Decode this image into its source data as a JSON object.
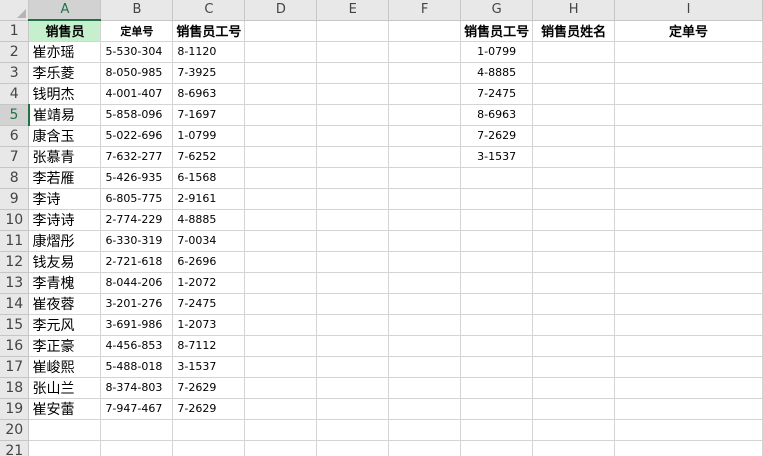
{
  "columns": [
    "A",
    "B",
    "C",
    "D",
    "E",
    "F",
    "G",
    "H",
    "I"
  ],
  "selected_column": "A",
  "selected_row": 5,
  "row_numbers": [
    "1",
    "2",
    "3",
    "4",
    "5",
    "6",
    "7",
    "8",
    "9",
    "10",
    "11",
    "12",
    "13",
    "14",
    "15",
    "16",
    "17",
    "18",
    "19",
    "20",
    "21"
  ],
  "headers": {
    "A1": "销售员",
    "B1": "定单号",
    "C1": "销售员工号",
    "G1": "销售员工号",
    "H1": "销售员姓名",
    "I1": "定单号"
  },
  "header_fill": "#c6efce",
  "records": [
    {
      "name": "崔亦瑶",
      "order": "5-530-304",
      "emp": "8-1120"
    },
    {
      "name": "李乐菱",
      "order": "8-050-985",
      "emp": "7-3925"
    },
    {
      "name": "钱明杰",
      "order": "4-001-407",
      "emp": "8-6963"
    },
    {
      "name": "崔靖易",
      "order": "5-858-096",
      "emp": "7-1697"
    },
    {
      "name": "康含玉",
      "order": "5-022-696",
      "emp": "1-0799"
    },
    {
      "name": "张慕青",
      "order": "7-632-277",
      "emp": "7-6252"
    },
    {
      "name": "李若雁",
      "order": "5-426-935",
      "emp": "6-1568"
    },
    {
      "name": "李诗",
      "order": "6-805-775",
      "emp": "2-9161"
    },
    {
      "name": "李诗诗",
      "order": "2-774-229",
      "emp": "4-8885"
    },
    {
      "name": "康熠彤",
      "order": "6-330-319",
      "emp": "7-0034"
    },
    {
      "name": "钱友易",
      "order": "2-721-618",
      "emp": "6-2696"
    },
    {
      "name": "李青槐",
      "order": "8-044-206",
      "emp": "1-2072"
    },
    {
      "name": "崔夜蓉",
      "order": "3-201-276",
      "emp": "7-2475"
    },
    {
      "name": "李元风",
      "order": "3-691-986",
      "emp": "1-2073"
    },
    {
      "name": "李正豪",
      "order": "4-456-853",
      "emp": "8-7112"
    },
    {
      "name": "崔峻熙",
      "order": "5-488-018",
      "emp": "3-1537"
    },
    {
      "name": "张山兰",
      "order": "8-374-803",
      "emp": "7-2629"
    },
    {
      "name": "崔安蕾",
      "order": "7-947-467",
      "emp": "7-2629"
    }
  ],
  "lookup_ids": [
    "1-0799",
    "4-8885",
    "7-2475",
    "8-6963",
    "7-2629",
    "3-1537"
  ]
}
